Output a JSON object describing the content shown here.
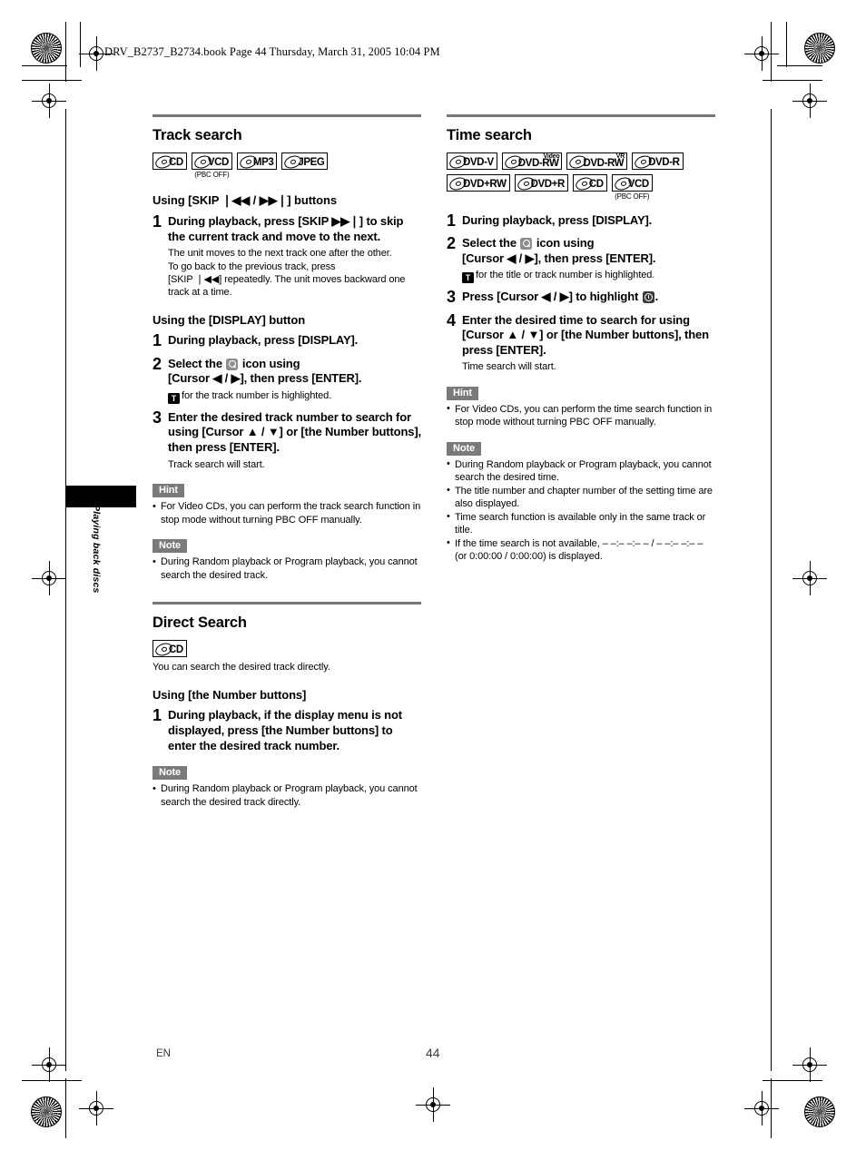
{
  "header": {
    "book_line": "DRV_B2737_B2734.book  Page 44  Thursday, March 31, 2005  10:04 PM"
  },
  "side_tab": {
    "label": "Playing back discs"
  },
  "footer": {
    "language": "EN",
    "page_number": "44"
  },
  "left_column": {
    "sections": [
      {
        "title": "Track search",
        "icons": [
          {
            "label": "CD",
            "sup": "",
            "note": ""
          },
          {
            "label": "VCD",
            "sup": "",
            "note": "(PBC OFF)"
          },
          {
            "label": "MP3",
            "sup": "",
            "note": ""
          },
          {
            "label": "JPEG",
            "sup": "",
            "note": ""
          }
        ],
        "groups": [
          {
            "subhead": "Using [SKIP ❘◀◀ / ▶▶❘] buttons",
            "steps": [
              {
                "num": "1",
                "instr": "During playback, press [SKIP ▶▶❘] to skip the current track and move to the next.",
                "desc_lines": [
                  "The unit moves to the next track one after the other.",
                  "To go back to the previous track, press",
                  "[SKIP ❘◀◀] repeatedly. The unit moves backward one track at a time."
                ]
              }
            ]
          },
          {
            "subhead": "Using the [DISPLAY] button",
            "steps": [
              {
                "num": "1",
                "instr": "During playback, press [DISPLAY]."
              },
              {
                "num": "2",
                "instr_a": "Select the",
                "instr_b": "icon using",
                "instr_c": "[Cursor ◀ / ▶], then press [ENTER].",
                "sub_note": "for the track number is highlighted."
              },
              {
                "num": "3",
                "instr": "Enter the desired track number to search for using [Cursor ▲ / ▼] or [the Number buttons], then press [ENTER].",
                "desc_lines": [
                  "Track search will start."
                ]
              }
            ]
          }
        ],
        "hint": {
          "label": "Hint",
          "items": [
            "For Video CDs, you can perform the track search function in stop mode without turning PBC OFF manually."
          ]
        },
        "note": {
          "label": "Note",
          "items": [
            "During Random playback or Program playback, you cannot search the desired track."
          ]
        }
      },
      {
        "title": "Direct Search",
        "icons": [
          {
            "label": "CD",
            "sup": "",
            "note": ""
          }
        ],
        "lead": "You can search the desired track directly.",
        "groups": [
          {
            "subhead": "Using [the Number buttons]",
            "steps": [
              {
                "num": "1",
                "instr": "During playback, if the display menu is not displayed, press [the Number buttons] to enter the desired track number."
              }
            ]
          }
        ],
        "note": {
          "label": "Note",
          "items": [
            "During Random playback or Program playback, you cannot search the desired track directly."
          ]
        }
      }
    ]
  },
  "right_column": {
    "sections": [
      {
        "title": "Time search",
        "icons_row1": [
          {
            "label": "DVD-V",
            "sup": "",
            "note": ""
          },
          {
            "label": "DVD-RW",
            "sup": "Video",
            "note": ""
          },
          {
            "label": "DVD-RW",
            "sup": "VR",
            "note": ""
          },
          {
            "label": "DVD-R",
            "sup": "",
            "note": ""
          }
        ],
        "icons_row2": [
          {
            "label": "DVD+RW",
            "sup": "",
            "note": ""
          },
          {
            "label": "DVD+R",
            "sup": "",
            "note": ""
          },
          {
            "label": "CD",
            "sup": "",
            "note": ""
          },
          {
            "label": "VCD",
            "sup": "",
            "note": "(PBC OFF)"
          }
        ],
        "steps": [
          {
            "num": "1",
            "instr": "During playback, press [DISPLAY]."
          },
          {
            "num": "2",
            "instr_a": "Select the",
            "instr_b": "icon using",
            "instr_c": "[Cursor ◀ / ▶], then press [ENTER].",
            "sub_note": "for the title or track number is highlighted."
          },
          {
            "num": "3",
            "instr_a": "Press [Cursor ◀ / ▶] to highlight",
            "instr_b": "."
          },
          {
            "num": "4",
            "instr": "Enter the desired time to search for using [Cursor ▲ / ▼] or [the Number buttons], then press [ENTER].",
            "desc_lines": [
              "Time search will start."
            ]
          }
        ],
        "hint": {
          "label": "Hint",
          "items": [
            "For Video CDs, you can perform the time search function in stop mode without turning PBC OFF manually."
          ]
        },
        "note": {
          "label": "Note",
          "items": [
            "During Random playback or Program playback, you cannot search the desired time.",
            "The title number and chapter number of the setting time are also displayed.",
            "Time search function is available only in the same track or title.",
            "If the time search is not available, – –:– –:– – / – –:– –:– – (or 0:00:00 / 0:00:00) is displayed."
          ]
        }
      }
    ]
  }
}
